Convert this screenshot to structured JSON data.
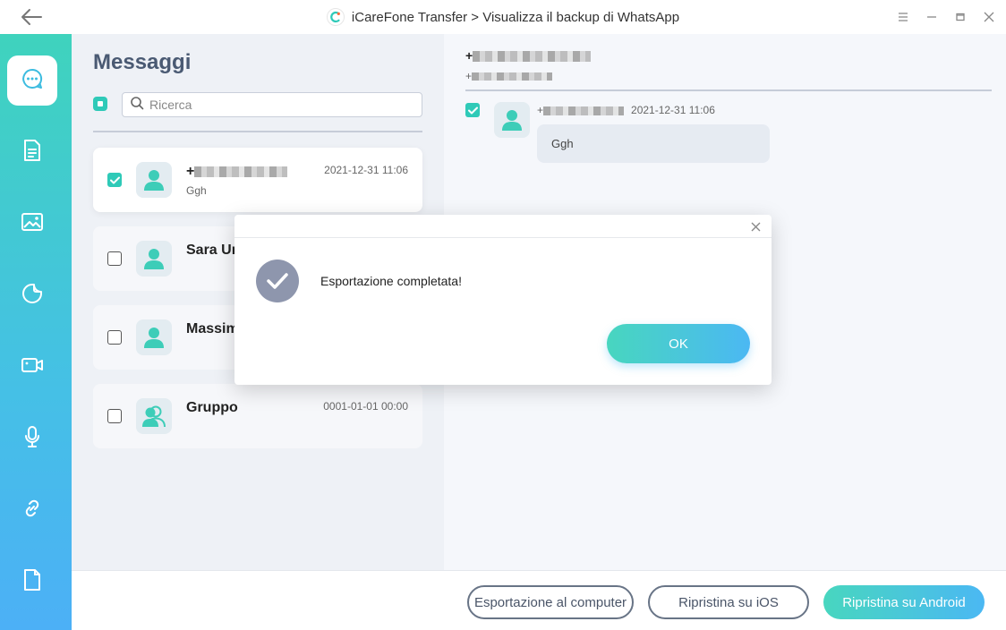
{
  "window": {
    "title": "iCareFone Transfer > Visualizza il backup di WhatsApp"
  },
  "list": {
    "title": "Messaggi",
    "search_placeholder": "Ricerca",
    "items": [
      {
        "name": "+",
        "preview": "Ggh",
        "time": "2021-12-31 11:06",
        "checked": true,
        "redacted": true
      },
      {
        "name": "Sara Ur",
        "preview": "",
        "time": "",
        "checked": false
      },
      {
        "name": "Massim",
        "preview": "",
        "time": "",
        "checked": false
      },
      {
        "name": "Gruppo",
        "preview": "",
        "time": "0001-01-01 00:00",
        "checked": false,
        "group": true
      }
    ]
  },
  "conversation": {
    "name": "+",
    "subtitle": "+",
    "message": {
      "sender": "+",
      "time": "2021-12-31 11:06",
      "text": "Ggh"
    }
  },
  "buttons": {
    "export_computer": "Esportazione al computer",
    "restore_ios": "Ripristina su iOS",
    "restore_android": "Ripristina su Android"
  },
  "modal": {
    "message": "Esportazione completata!",
    "ok": "OK"
  },
  "colors": {
    "accent": "#2fcab8",
    "gradient_start": "#48d6bf",
    "gradient_end": "#4bb8f3",
    "title_text": "#4a5a73"
  },
  "sidebar": {
    "icons": [
      "chat-icon",
      "document-icon",
      "image-icon",
      "sticker-icon",
      "video-icon",
      "microphone-icon",
      "link-icon",
      "file-icon"
    ]
  }
}
